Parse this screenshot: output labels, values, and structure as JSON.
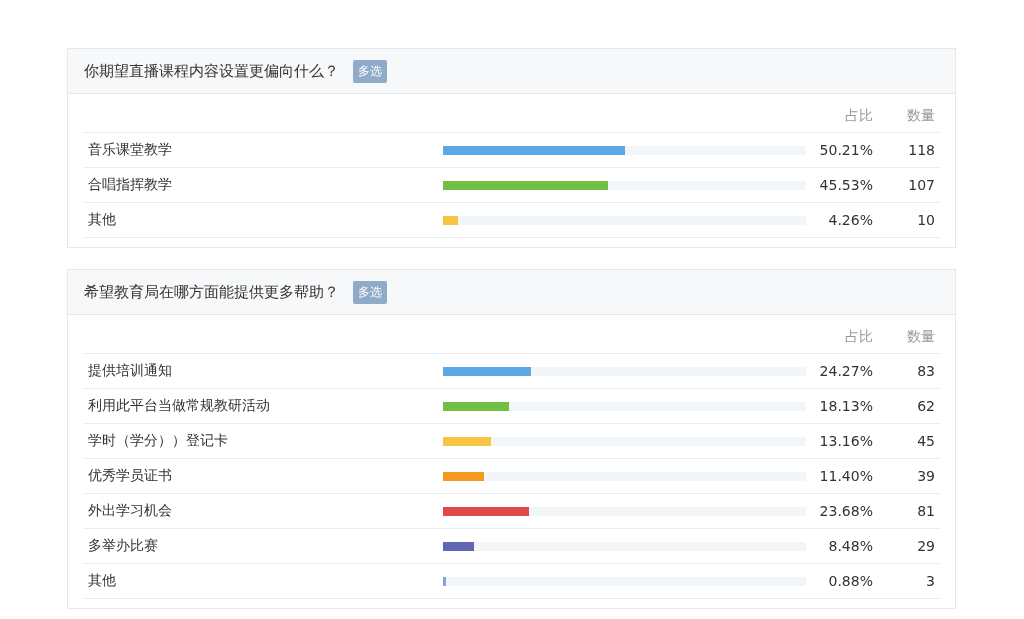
{
  "questions": [
    {
      "title": "你期望直播课程内容设置更偏向什么？",
      "tag": "多选",
      "columns": {
        "ratio": "占比",
        "count": "数量"
      },
      "options": [
        {
          "label": "音乐课堂教学",
          "level": 0.5021,
          "color": "#5ba8e6",
          "ratio": "50.21%",
          "count": "118"
        },
        {
          "label": "合唱指挥教学",
          "level": 0.4553,
          "color": "#73bf45",
          "ratio": "45.53%",
          "count": "107"
        },
        {
          "label": "其他",
          "level": 0.0426,
          "color": "#f8c443",
          "ratio": "4.26%",
          "count": "10"
        }
      ]
    },
    {
      "title": "希望教育局在哪方面能提供更多帮助？",
      "tag": "多选",
      "columns": {
        "ratio": "占比",
        "count": "数量"
      },
      "options": [
        {
          "label": "提供培训通知",
          "level": 0.2427,
          "color": "#5ba8e6",
          "ratio": "24.27%",
          "count": "83"
        },
        {
          "label": "利用此平台当做常规教研活动",
          "level": 0.1813,
          "color": "#73bf45",
          "ratio": "18.13%",
          "count": "62"
        },
        {
          "label": "学时（学分））登记卡",
          "level": 0.1316,
          "color": "#f8c443",
          "ratio": "13.16%",
          "count": "45"
        },
        {
          "label": "优秀学员证书",
          "level": 0.114,
          "color": "#f29b1e",
          "ratio": "11.40%",
          "count": "39"
        },
        {
          "label": "外出学习机会",
          "level": 0.2368,
          "color": "#e04a4a",
          "ratio": "23.68%",
          "count": "81"
        },
        {
          "label": "多举办比赛",
          "level": 0.0848,
          "color": "#6165b2",
          "ratio": "8.48%",
          "count": "29"
        },
        {
          "label": "其他",
          "level": 0.0088,
          "color": "#7ea6d8",
          "ratio": "0.88%",
          "count": "3"
        }
      ]
    }
  ]
}
